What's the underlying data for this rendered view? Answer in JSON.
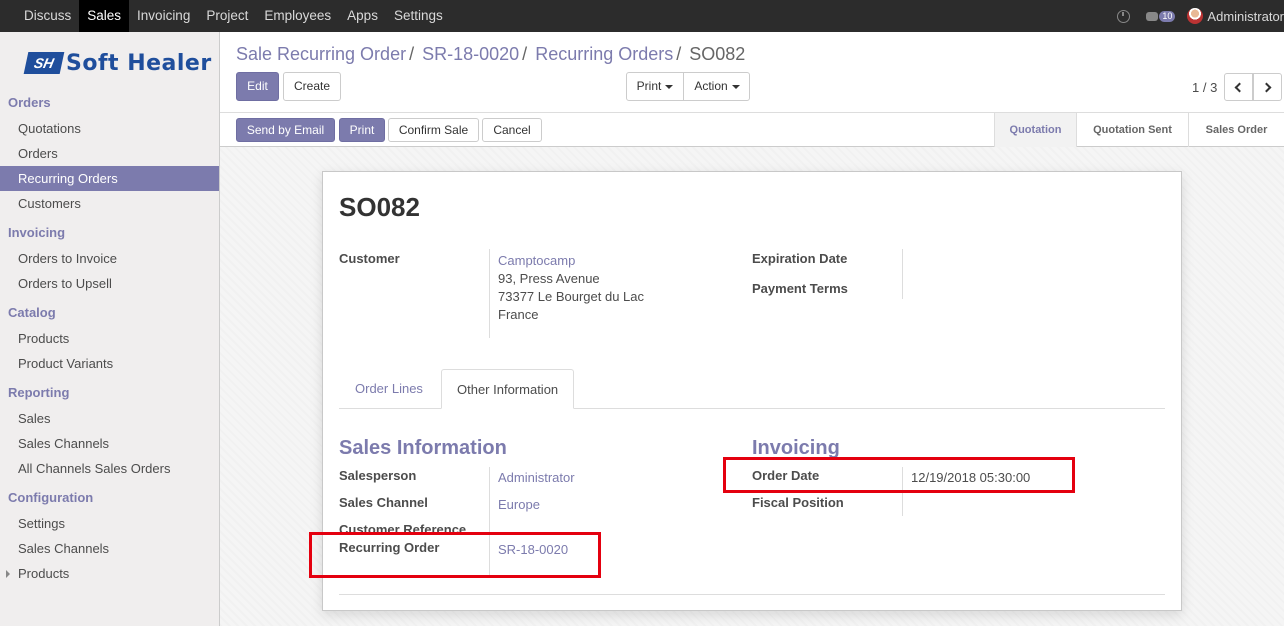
{
  "topbar": {
    "menu": [
      "Discuss",
      "Sales",
      "Invoicing",
      "Project",
      "Employees",
      "Apps",
      "Settings"
    ],
    "active_index": 1,
    "message_count": "10",
    "user": "Administrator"
  },
  "logo": {
    "mark": "SH",
    "text": "Soft Healer"
  },
  "sidebar": {
    "sections": [
      {
        "title": "Orders",
        "items": [
          "Quotations",
          "Orders",
          "Recurring Orders",
          "Customers"
        ]
      },
      {
        "title": "Invoicing",
        "items": [
          "Orders to Invoice",
          "Orders to Upsell"
        ]
      },
      {
        "title": "Catalog",
        "items": [
          "Products",
          "Product Variants"
        ]
      },
      {
        "title": "Reporting",
        "items": [
          "Sales",
          "Sales Channels",
          "All Channels Sales Orders"
        ]
      },
      {
        "title": "Configuration",
        "items": [
          "Settings",
          "Sales Channels",
          "Products"
        ]
      }
    ],
    "active_item": "Recurring Orders"
  },
  "breadcrumb": {
    "items": [
      "Sale Recurring Order",
      "SR-18-0020",
      "Recurring Orders"
    ],
    "current": "SO082"
  },
  "buttons": {
    "edit": "Edit",
    "create": "Create",
    "print": "Print",
    "action": "Action",
    "send_email": "Send by Email",
    "print2": "Print",
    "confirm": "Confirm Sale",
    "cancel": "Cancel"
  },
  "pager": {
    "text": "1 / 3"
  },
  "status_steps": [
    "Quotation",
    "Quotation Sent",
    "Sales Order"
  ],
  "status_active": "Quotation",
  "record": {
    "name": "SO082",
    "customer_label": "Customer",
    "customer_name": "Camptocamp",
    "address": [
      "93, Press Avenue",
      "73377 Le Bourget du Lac",
      "France"
    ],
    "expiration_label": "Expiration Date",
    "payment_terms_label": "Payment Terms"
  },
  "tabs": [
    "Order Lines",
    "Other Information"
  ],
  "active_tab": "Other Information",
  "sales_info": {
    "title": "Sales Information",
    "salesperson_label": "Salesperson",
    "salesperson": "Administrator",
    "channel_label": "Sales Channel",
    "channel": "Europe",
    "customer_ref_label": "Customer Reference",
    "recurring_label": "Recurring Order",
    "recurring": "SR-18-0020"
  },
  "invoicing": {
    "title": "Invoicing",
    "order_date_label": "Order Date",
    "order_date": "12/19/2018 05:30:00",
    "fiscal_label": "Fiscal Position"
  },
  "colors": {
    "accent": "#7c7bad",
    "highlight": "#e4000f",
    "topbar": "#2c2c2c"
  }
}
